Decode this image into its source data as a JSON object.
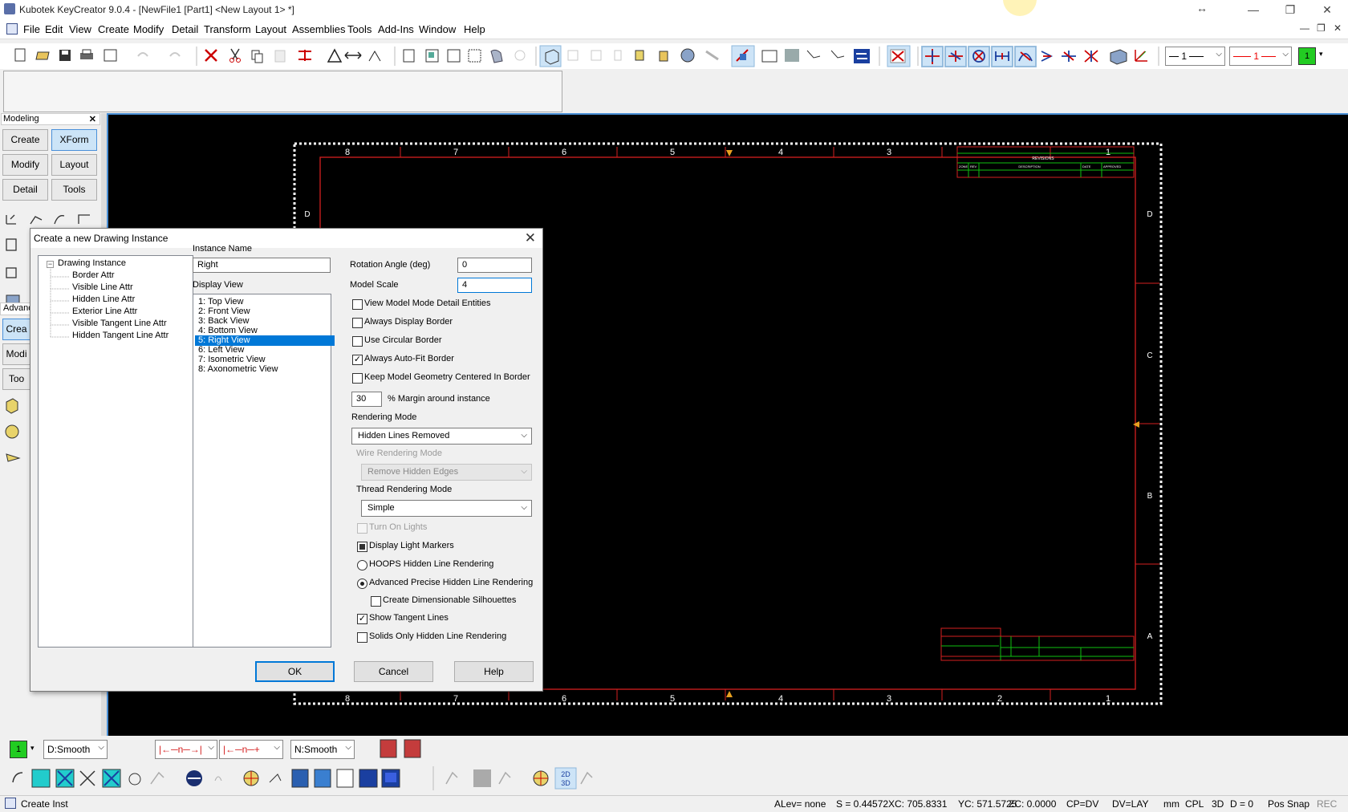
{
  "window": {
    "title": "Kubotek KeyCreator 9.0.4 - [NewFile1 [Part1] <New Layout 1> *]"
  },
  "menu": [
    "File",
    "Edit",
    "View",
    "Create",
    "Modify",
    "Detail",
    "Transform",
    "Layout",
    "Assemblies",
    "Tools",
    "Add-Ins",
    "Window",
    "Help"
  ],
  "toolbar": {
    "line_style": "1",
    "line_color_label": "1",
    "color_index": "1"
  },
  "modeling_panel": {
    "title": "Modeling",
    "buttons": [
      "Create",
      "XForm",
      "Modify",
      "Layout",
      "Detail",
      "Tools"
    ],
    "advanced_title": "Advanc",
    "advanced_buttons": [
      "Crea",
      "Modi",
      "Too"
    ]
  },
  "dialog": {
    "title": "Create a new Drawing Instance",
    "tree_root": "Drawing Instance",
    "tree_items": [
      "Border Attr",
      "Visible Line Attr",
      "Hidden Line Attr",
      "Exterior Line Attr",
      "Visible Tangent Line Attr",
      "Hidden Tangent Line Attr"
    ],
    "instance_name_label": "Instance Name",
    "instance_name": "Right",
    "display_view_label": "Display View",
    "views": [
      "1: Top View",
      "2: Front View",
      "3: Back View",
      "4: Bottom View",
      "5: Right View",
      "6: Left View",
      "7: Isometric View",
      "8: Axonometric View"
    ],
    "selected_view": "5: Right View",
    "rotation_label": "Rotation Angle (deg)",
    "rotation_value": "0",
    "scale_label": "Model Scale",
    "scale_value": "4",
    "options": {
      "view_model_mode": "View Model Mode Detail Entities",
      "always_display_border": "Always Display Border",
      "use_circular_border": "Use Circular Border",
      "always_auto_fit": "Always Auto-Fit Border",
      "keep_centered": "Keep Model Geometry Centered In Border"
    },
    "margin_value": "30",
    "margin_label": "% Margin around instance",
    "rendering_mode_label": "Rendering Mode",
    "rendering_mode": "Hidden Lines Removed",
    "wire_rendering_label": "Wire Rendering Mode",
    "wire_rendering": "Remove Hidden Edges",
    "thread_rendering_label": "Thread Rendering Mode",
    "thread_rendering": "Simple",
    "turn_on_lights": "Turn On Lights",
    "display_light_markers": "Display Light Markers",
    "hoops_hidden": "HOOPS Hidden Line Rendering",
    "advanced_precise": "Advanced Precise Hidden Line Rendering",
    "create_dimensionable": "Create Dimensionable Silhouettes",
    "show_tangent": "Show Tangent Lines",
    "solids_only": "Solids Only Hidden Line Rendering",
    "ok": "OK",
    "cancel": "Cancel",
    "help": "Help"
  },
  "drawing": {
    "col_labels": [
      "8",
      "7",
      "6",
      "5",
      "4",
      "3",
      "2",
      "1"
    ],
    "row_labels": [
      "D",
      "C",
      "B",
      "A"
    ],
    "row_label_left": "D",
    "rev_title": "REVISIONS",
    "rev_headers": [
      "ZONE",
      "REV",
      "DESCRIPTION",
      "DATE",
      "APPROVED"
    ]
  },
  "bottom": {
    "color": "1",
    "dsmooth": "D:Smooth",
    "nsmooth": "N:Smooth"
  },
  "status": {
    "command": "Create Inst",
    "alev": "ALev= none",
    "s": "S = 0.44572",
    "xc": "XC: 705.8331",
    "yc": "YC: 571.5725",
    "zc": "ZC: 0.0000",
    "cp": "CP=DV",
    "dv": "DV=LAY",
    "units": "mm",
    "cpl": "CPL",
    "mode": "3D",
    "d": "D = 0",
    "snap": "Pos Snap",
    "rec": "REC"
  },
  "colors": {
    "accent": "#0078d7",
    "border_red": "#d42020",
    "title_green": "#10c010",
    "viewport_bg": "#000000"
  }
}
